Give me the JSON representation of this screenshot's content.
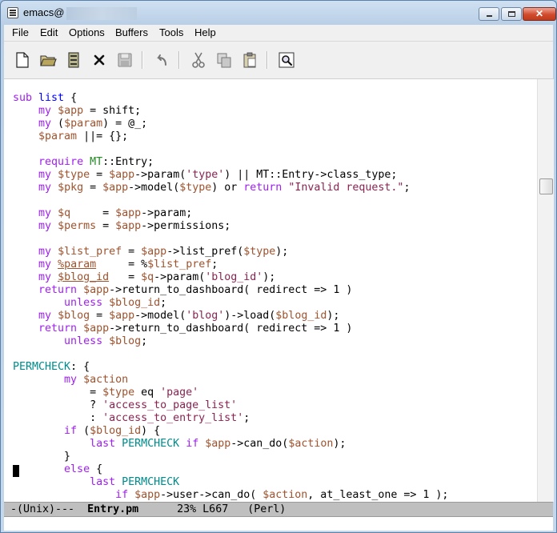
{
  "window": {
    "title": "emacs@"
  },
  "menubar": {
    "items": [
      "File",
      "Edit",
      "Options",
      "Buffers",
      "Tools",
      "Help"
    ]
  },
  "toolbar": {
    "buttons": [
      "new-file-icon",
      "open-folder-icon",
      "dired-icon",
      "kill-buffer-icon",
      "save-icon",
      "undo-icon",
      "cut-icon",
      "copy-icon",
      "paste-icon",
      "search-icon"
    ]
  },
  "editor": {
    "lines": [
      [
        [
          "sub ",
          "kw"
        ],
        [
          "list",
          "fn"
        ],
        [
          " {",
          ""
        ]
      ],
      [
        [
          "    ",
          ""
        ],
        [
          "my",
          "kw"
        ],
        [
          " ",
          ""
        ],
        [
          "$app",
          "var"
        ],
        [
          " = shift;",
          ""
        ]
      ],
      [
        [
          "    ",
          ""
        ],
        [
          "my",
          "kw"
        ],
        [
          " (",
          ""
        ],
        [
          "$param",
          "var"
        ],
        [
          ") = @_;",
          ""
        ]
      ],
      [
        [
          "    ",
          ""
        ],
        [
          "$param",
          "var"
        ],
        [
          " ||= {};",
          ""
        ]
      ],
      [
        [
          "",
          ""
        ]
      ],
      [
        [
          "    ",
          ""
        ],
        [
          "require",
          "kw"
        ],
        [
          " ",
          ""
        ],
        [
          "MT",
          "type"
        ],
        [
          "::Entry;",
          ""
        ]
      ],
      [
        [
          "    ",
          ""
        ],
        [
          "my",
          "kw"
        ],
        [
          " ",
          ""
        ],
        [
          "$type",
          "var"
        ],
        [
          " = ",
          ""
        ],
        [
          "$app",
          "var"
        ],
        [
          "->param(",
          ""
        ],
        [
          "'type'",
          "str"
        ],
        [
          ") || MT::Entry->class_type;",
          ""
        ]
      ],
      [
        [
          "    ",
          ""
        ],
        [
          "my",
          "kw"
        ],
        [
          " ",
          ""
        ],
        [
          "$pkg",
          "var"
        ],
        [
          " = ",
          ""
        ],
        [
          "$app",
          "var"
        ],
        [
          "->model(",
          ""
        ],
        [
          "$type",
          "var"
        ],
        [
          ") or ",
          ""
        ],
        [
          "return",
          "kw"
        ],
        [
          " ",
          ""
        ],
        [
          "\"Invalid request.\"",
          "str"
        ],
        [
          ";",
          ""
        ]
      ],
      [
        [
          "",
          ""
        ]
      ],
      [
        [
          "    ",
          ""
        ],
        [
          "my",
          "kw"
        ],
        [
          " ",
          ""
        ],
        [
          "$q",
          "var"
        ],
        [
          "     = ",
          ""
        ],
        [
          "$app",
          "var"
        ],
        [
          "->param;",
          ""
        ]
      ],
      [
        [
          "    ",
          ""
        ],
        [
          "my",
          "kw"
        ],
        [
          " ",
          ""
        ],
        [
          "$perms",
          "var"
        ],
        [
          " = ",
          ""
        ],
        [
          "$app",
          "var"
        ],
        [
          "->permissions;",
          ""
        ]
      ],
      [
        [
          "",
          ""
        ]
      ],
      [
        [
          "    ",
          ""
        ],
        [
          "my",
          "kw"
        ],
        [
          " ",
          ""
        ],
        [
          "$list_pref",
          "var"
        ],
        [
          " = ",
          ""
        ],
        [
          "$app",
          "var"
        ],
        [
          "->list_pref(",
          ""
        ],
        [
          "$type",
          "var"
        ],
        [
          ");",
          ""
        ]
      ],
      [
        [
          "    ",
          ""
        ],
        [
          "my",
          "kw"
        ],
        [
          " ",
          ""
        ],
        [
          "%param",
          "warn"
        ],
        [
          "     = %",
          ""
        ],
        [
          "$list_pref",
          "var"
        ],
        [
          ";",
          ""
        ]
      ],
      [
        [
          "    ",
          ""
        ],
        [
          "my",
          "kw"
        ],
        [
          " ",
          ""
        ],
        [
          "$blog_id",
          "warn"
        ],
        [
          "   = ",
          ""
        ],
        [
          "$q",
          "var"
        ],
        [
          "->param(",
          ""
        ],
        [
          "'blog_id'",
          "str"
        ],
        [
          ");",
          ""
        ]
      ],
      [
        [
          "    ",
          ""
        ],
        [
          "return",
          "kw"
        ],
        [
          " ",
          ""
        ],
        [
          "$app",
          "var"
        ],
        [
          "->return_to_dashboard( redirect => 1 )",
          ""
        ]
      ],
      [
        [
          "        ",
          ""
        ],
        [
          "unless",
          "kw"
        ],
        [
          " ",
          ""
        ],
        [
          "$blog_id",
          "var"
        ],
        [
          ";",
          ""
        ]
      ],
      [
        [
          "    ",
          ""
        ],
        [
          "my",
          "kw"
        ],
        [
          " ",
          ""
        ],
        [
          "$blog",
          "var"
        ],
        [
          " = ",
          ""
        ],
        [
          "$app",
          "var"
        ],
        [
          "->model(",
          ""
        ],
        [
          "'blog'",
          "str"
        ],
        [
          ")->load(",
          ""
        ],
        [
          "$blog_id",
          "var"
        ],
        [
          ");",
          ""
        ]
      ],
      [
        [
          "    ",
          ""
        ],
        [
          "return",
          "kw"
        ],
        [
          " ",
          ""
        ],
        [
          "$app",
          "var"
        ],
        [
          "->return_to_dashboard( redirect => 1 )",
          ""
        ]
      ],
      [
        [
          "        ",
          ""
        ],
        [
          "unless",
          "kw"
        ],
        [
          " ",
          ""
        ],
        [
          "$blog",
          "var"
        ],
        [
          ";",
          ""
        ]
      ],
      [
        [
          "",
          ""
        ]
      ],
      [
        [
          "PERMCHECK",
          "const"
        ],
        [
          ": {",
          ""
        ]
      ],
      [
        [
          "        ",
          ""
        ],
        [
          "my",
          "kw"
        ],
        [
          " ",
          ""
        ],
        [
          "$action",
          "var"
        ]
      ],
      [
        [
          "            = ",
          ""
        ],
        [
          "$type",
          "var"
        ],
        [
          " eq ",
          ""
        ],
        [
          "'page'",
          "str"
        ]
      ],
      [
        [
          "            ? ",
          ""
        ],
        [
          "'access_to_page_list'",
          "str"
        ]
      ],
      [
        [
          "            : ",
          ""
        ],
        [
          "'access_to_entry_list'",
          "str"
        ],
        [
          ";",
          ""
        ]
      ],
      [
        [
          "        ",
          ""
        ],
        [
          "if",
          "kw"
        ],
        [
          " (",
          ""
        ],
        [
          "$blog_id",
          "var"
        ],
        [
          ") {",
          ""
        ]
      ],
      [
        [
          "            ",
          ""
        ],
        [
          "last",
          "kw"
        ],
        [
          " ",
          ""
        ],
        [
          "PERMCHECK",
          "const"
        ],
        [
          " ",
          ""
        ],
        [
          "if",
          "kw"
        ],
        [
          " ",
          ""
        ],
        [
          "$app",
          "var"
        ],
        [
          "->can_do(",
          ""
        ],
        [
          "$action",
          "var"
        ],
        [
          ");",
          ""
        ]
      ],
      [
        [
          "        }",
          ""
        ]
      ],
      [
        [
          "        ",
          ""
        ],
        [
          "else",
          "kw"
        ],
        [
          " {",
          ""
        ]
      ],
      [
        [
          "            ",
          ""
        ],
        [
          "last",
          "kw"
        ],
        [
          " ",
          ""
        ],
        [
          "PERMCHECK",
          "const"
        ]
      ],
      [
        [
          "                ",
          ""
        ],
        [
          "if",
          "kw"
        ],
        [
          " ",
          ""
        ],
        [
          "$app",
          "var"
        ],
        [
          "->user->can_do( ",
          ""
        ],
        [
          "$action",
          "var"
        ],
        [
          ", at_least_one => 1 );",
          ""
        ]
      ]
    ]
  },
  "modeline": {
    "prefix": "-(Unix)---  ",
    "buffer_name": "Entry.pm",
    "position": "      23% L667   (Perl)"
  },
  "scrollbar": {
    "position_fraction": 0.23
  }
}
